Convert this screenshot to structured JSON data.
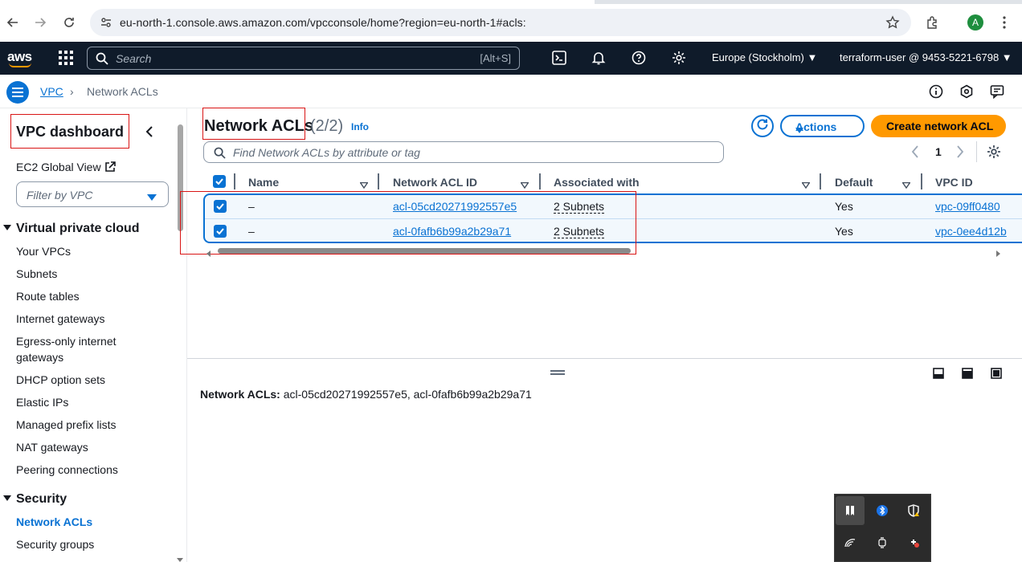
{
  "browser": {
    "url": "eu-north-1.console.aws.amazon.com/vpcconsole/home?region=eu-north-1#acls:",
    "profile_initial": "A"
  },
  "aws_nav": {
    "logo": "aws",
    "search_placeholder": "Search",
    "search_shortcut": "[Alt+S]",
    "region": "Europe (Stockholm) ▼",
    "user": "terraform-user @ 9453-5221-6798 ▼"
  },
  "breadcrumb": {
    "root": "VPC",
    "separator": "›",
    "current": "Network ACLs"
  },
  "sidebar": {
    "title": "VPC dashboard",
    "ec2_link": "EC2 Global View",
    "filter_placeholder": "Filter by VPC",
    "sections": [
      {
        "title": "Virtual private cloud",
        "items": [
          "Your VPCs",
          "Subnets",
          "Route tables",
          "Internet gateways",
          "Egress-only internet gateways",
          "DHCP option sets",
          "Elastic IPs",
          "Managed prefix lists",
          "NAT gateways",
          "Peering connections"
        ]
      },
      {
        "title": "Security",
        "items": [
          "Network ACLs",
          "Security groups"
        ]
      }
    ]
  },
  "main": {
    "title": "Network ACLs",
    "count": "(2/2)",
    "info": "Info",
    "actions_label": "Actions",
    "create_label": "Create network ACL",
    "search_placeholder": "Find Network ACLs by attribute or tag",
    "current_page": "1",
    "columns": [
      "Name",
      "Network ACL ID",
      "Associated with",
      "Default",
      "VPC ID"
    ],
    "rows": [
      {
        "name": "–",
        "acl_id": "acl-05cd20271992557e5",
        "associated": "2 Subnets",
        "default": "Yes",
        "vpc_id": "vpc-09ff0480"
      },
      {
        "name": "–",
        "acl_id": "acl-0fafb6b99a2b29a71",
        "associated": "2 Subnets",
        "default": "Yes",
        "vpc_id": "vpc-0ee4d12b"
      }
    ],
    "split_panel": {
      "label": "Network ACLs:",
      "value": "acl-05cd20271992557e5, acl-0fafb6b99a2b29a71"
    }
  },
  "colors": {
    "accent": "#0972d3",
    "primary_button": "#ff9900",
    "nav_bg": "#0f1b2a",
    "highlight_box": "#d91515"
  }
}
